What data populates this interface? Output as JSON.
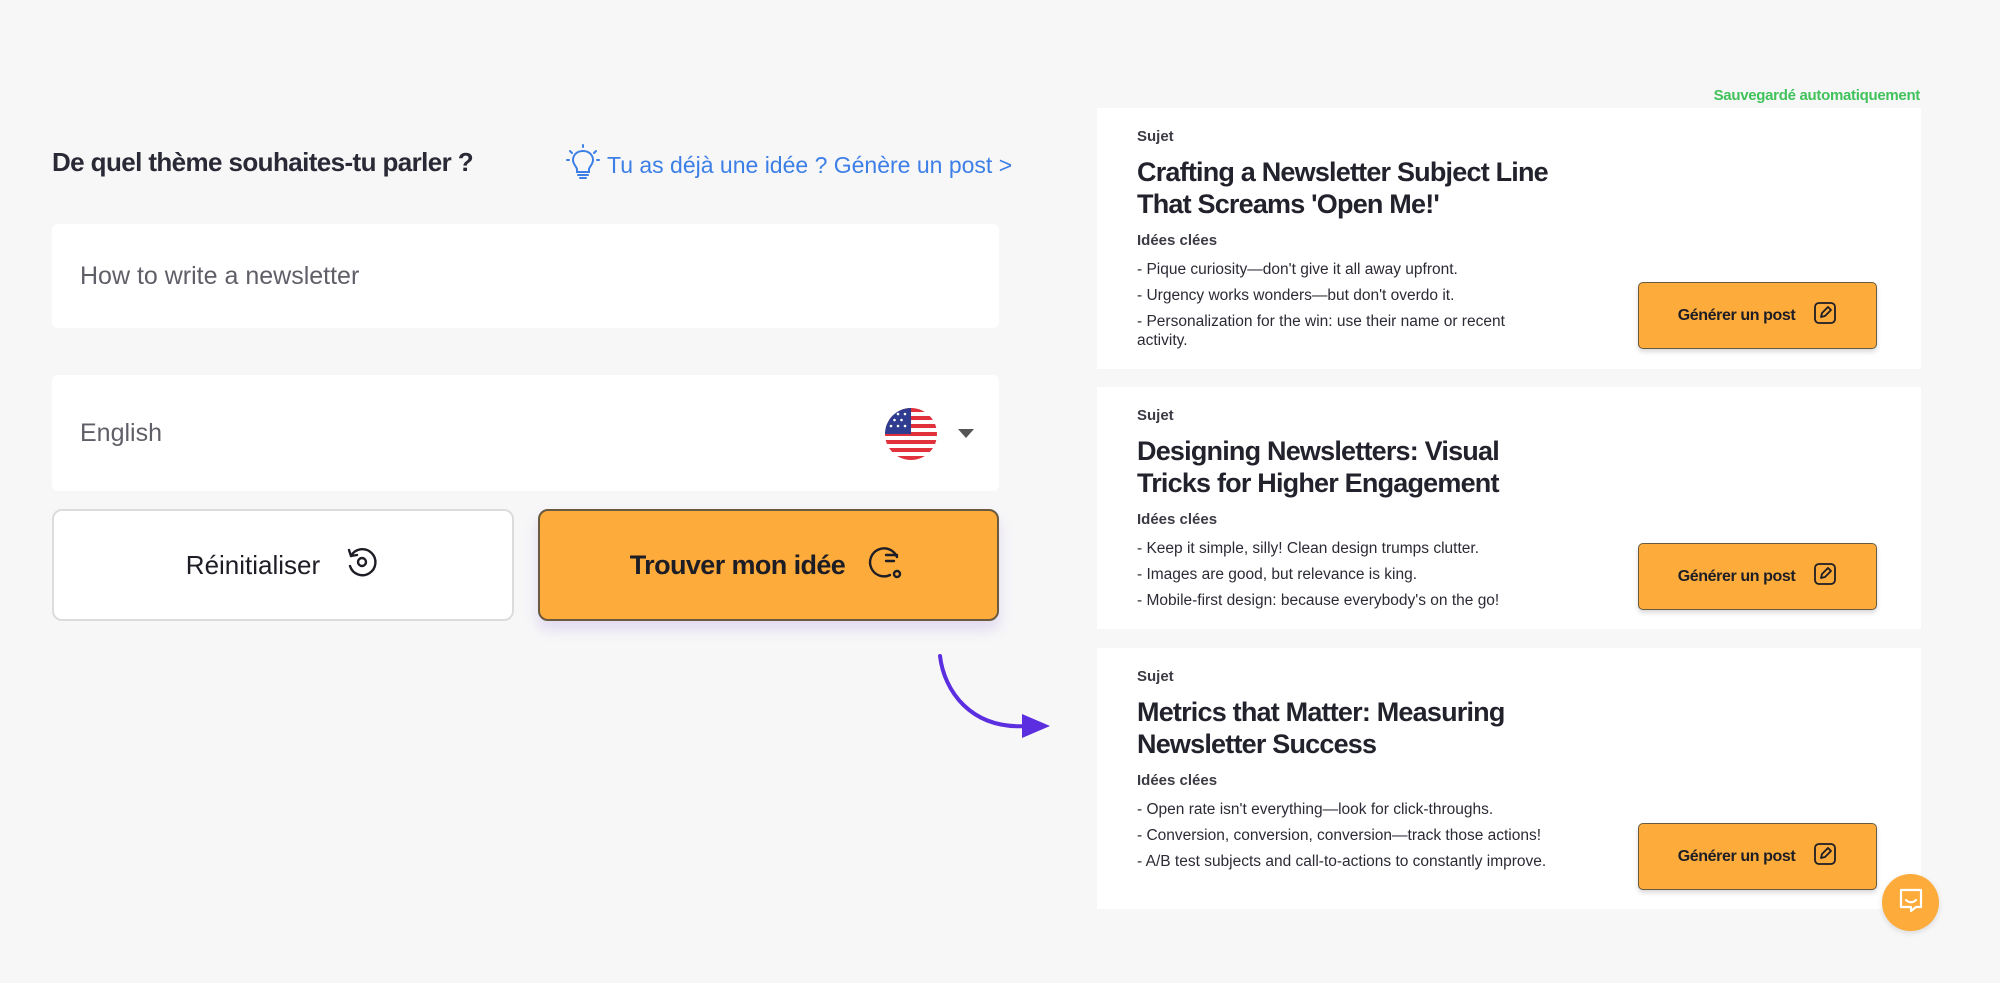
{
  "left": {
    "title": "De quel thème souhaites-tu parler ?",
    "idea_link": "Tu as déjà une idée ? Génère un post >",
    "topic_value": "How to write a newsletter",
    "language": "English",
    "language_flag_icon": "us-flag-icon",
    "reset_label": "Réinitialiser",
    "find_label": "Trouver mon idée"
  },
  "right": {
    "autosave": "Sauvegardé automatiquement",
    "cards": [
      {
        "subject_label": "Sujet",
        "title": "Crafting a Newsletter Subject Line That Screams 'Open Me!'",
        "ideas_label": "Idées clées",
        "ideas": [
          "- Pique curiosity—don't give it all away upfront.",
          "- Urgency works wonders—but don't overdo it.",
          "- Personalization for the win: use their name or recent activity."
        ],
        "button": "Générer un post"
      },
      {
        "subject_label": "Sujet",
        "title": "Designing Newsletters: Visual Tricks for Higher Engagement",
        "ideas_label": "Idées clées",
        "ideas": [
          "- Keep it simple, silly! Clean design trumps clutter.",
          "- Images are good, but relevance is king.",
          "- Mobile-first design: because everybody's on the go!"
        ],
        "button": "Générer un post"
      },
      {
        "subject_label": "Sujet",
        "title": "Metrics that Matter: Measuring Newsletter Success",
        "ideas_label": "Idées clées",
        "ideas": [
          "- Open rate isn't everything—look for click-throughs.",
          "- Conversion, conversion, conversion—track those actions!",
          "- A/B test subjects and call-to-actions to constantly improve."
        ],
        "button": "Générer un post"
      }
    ]
  },
  "colors": {
    "accent": "#fdab3a",
    "link": "#3d7fe6",
    "autosave": "#3fc25a",
    "arrow": "#5b2ee0"
  }
}
